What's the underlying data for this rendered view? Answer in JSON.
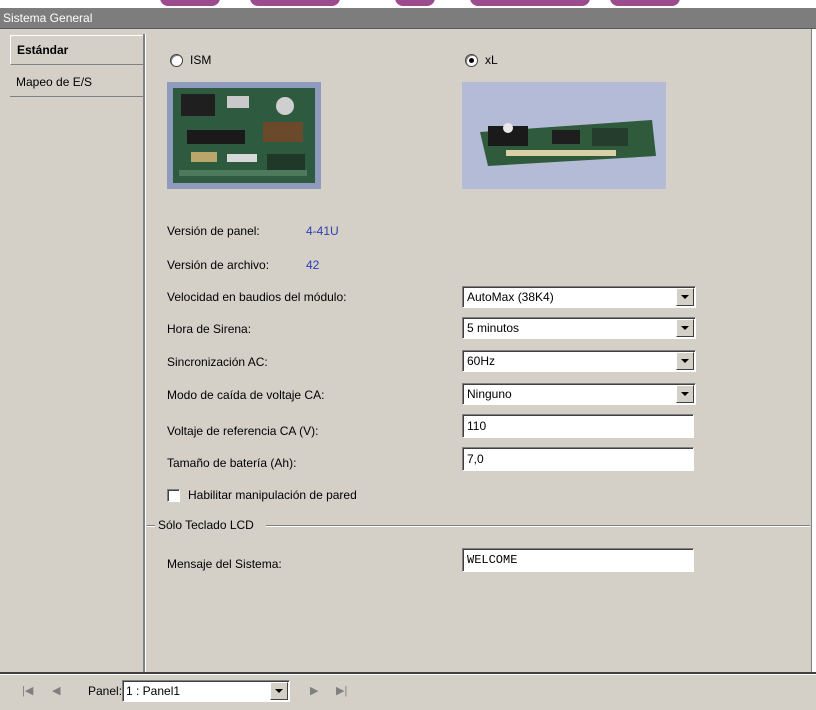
{
  "window": {
    "title": "Sistema General"
  },
  "tabs": [
    {
      "label": "Estándar",
      "active": true
    },
    {
      "label": "Mapeo de E/S",
      "active": false
    }
  ],
  "panel_types": [
    {
      "label": "ISM",
      "selected": false
    },
    {
      "label": "xL",
      "selected": true
    }
  ],
  "info": {
    "panel_version_label": "Versión de panel:",
    "panel_version_value": "4-41U",
    "file_version_label": "Versión de archivo:",
    "file_version_value": "42"
  },
  "fields": [
    {
      "label": "Velocidad en baudios del módulo:",
      "type": "select",
      "value": "AutoMax (38K4)"
    },
    {
      "label": "Hora de Sirena:",
      "type": "select",
      "value": "5 minutos"
    },
    {
      "label": "Sincronización AC:",
      "type": "select",
      "value": "60Hz"
    },
    {
      "label": "Modo de caída de voltaje CA:",
      "type": "select",
      "value": "Ninguno"
    },
    {
      "label": "Voltaje de referencia CA (V):",
      "type": "text",
      "value": "110"
    },
    {
      "label": "Tamaño de batería (Ah):",
      "type": "text",
      "value": "7,0"
    }
  ],
  "wall_tamper": {
    "label": "Habilitar manipulación de pared",
    "checked": false
  },
  "lcd_group": {
    "title": "Sólo Teclado LCD",
    "message_label": "Mensaje del Sistema:",
    "message_value": "WELCOME"
  },
  "navigator": {
    "panel_label": "Panel:",
    "panel_value": "1 : Panel1"
  },
  "colors": {
    "face": "#d4d0c8",
    "title_bar": "#7d7d7d",
    "value_blue": "#2b3fb0"
  },
  "icons": [
    "first-record-icon",
    "previous-record-icon",
    "next-record-icon",
    "last-record-icon",
    "chevron-down-icon"
  ]
}
